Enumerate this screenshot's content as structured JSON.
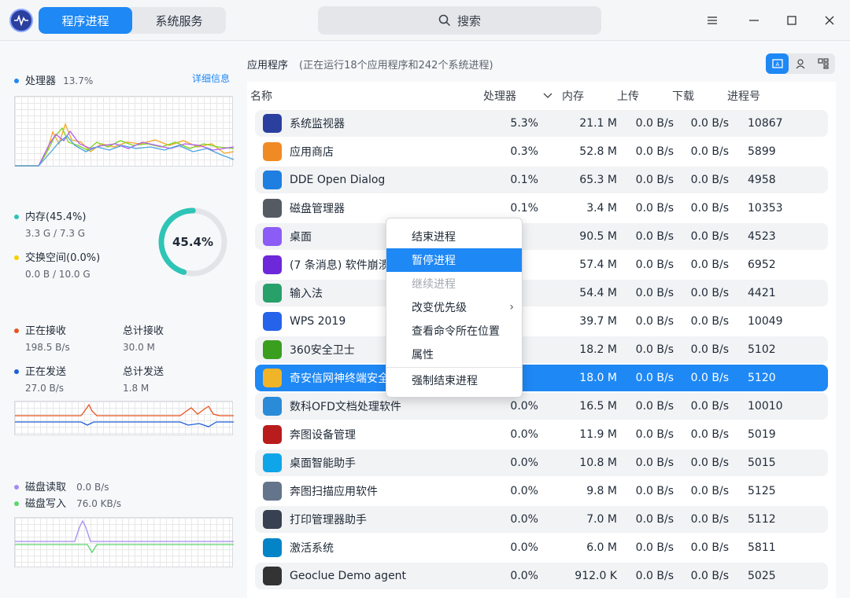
{
  "header": {
    "tabs": [
      "程序进程",
      "系统服务"
    ],
    "search_placeholder": "搜索"
  },
  "left": {
    "cpu": {
      "label": "处理器",
      "value": "13.7%",
      "detail_link": "详细信息"
    },
    "memory": {
      "label": "内存(45.4%)",
      "value": "3.3 G / 7.3 G",
      "percent": "45.4%"
    },
    "swap": {
      "label": "交换空间(0.0%)",
      "value": "0.0 B / 10.0 G"
    },
    "net": {
      "recv_label": "正在接收",
      "recv_value": "198.5 B/s",
      "total_recv_label": "总计接收",
      "total_recv_value": "30.0 M",
      "send_label": "正在发送",
      "send_value": "27.0 B/s",
      "total_send_label": "总计发送",
      "total_send_value": "1.8 M"
    },
    "disk": {
      "read_label": "磁盘读取",
      "read_value": "0.0 B/s",
      "write_label": "磁盘写入",
      "write_value": "76.0 KB/s"
    }
  },
  "main": {
    "title": "应用程序",
    "count": "(正在运行18个应用程序和242个系统进程)",
    "columns": [
      "名称",
      "处理器",
      "内存",
      "上传",
      "下载",
      "进程号"
    ],
    "rows": [
      {
        "name": "系统监视器",
        "cpu": "5.3%",
        "mem": "21.1 M",
        "up": "0.0 B/s",
        "down": "0.0 B/s",
        "pid": "10867",
        "icon": "monitor-icon",
        "color": "#2b3f9f"
      },
      {
        "name": "应用商店",
        "cpu": "0.3%",
        "mem": "52.8 M",
        "up": "0.0 B/s",
        "down": "0.0 B/s",
        "pid": "5899",
        "icon": "store-icon",
        "color": "#f08a24"
      },
      {
        "name": "DDE Open Dialog",
        "cpu": "0.1%",
        "mem": "65.3 M",
        "up": "0.0 B/s",
        "down": "0.0 B/s",
        "pid": "4958",
        "icon": "dialog-icon",
        "color": "#1e7fe0"
      },
      {
        "name": "磁盘管理器",
        "cpu": "0.1%",
        "mem": "3.4 M",
        "up": "0.0 B/s",
        "down": "0.0 B/s",
        "pid": "10353",
        "icon": "disk-icon",
        "color": "#555b63"
      },
      {
        "name": "桌面",
        "cpu": "",
        "mem": "90.5 M",
        "up": "0.0 B/s",
        "down": "0.0 B/s",
        "pid": "4523",
        "icon": "desktop-icon",
        "color": "#8b5cf6"
      },
      {
        "name": "(7 条消息) 软件崩溃",
        "cpu": "",
        "mem": "57.4 M",
        "up": "0.0 B/s",
        "down": "0.0 B/s",
        "pid": "6952",
        "icon": "browser-icon",
        "color": "#6d28d9"
      },
      {
        "name": "输入法",
        "cpu": "",
        "mem": "54.4 M",
        "up": "0.0 B/s",
        "down": "0.0 B/s",
        "pid": "4421",
        "icon": "keyboard-icon",
        "color": "#27a06a"
      },
      {
        "name": "WPS 2019",
        "cpu": "",
        "mem": "39.7 M",
        "up": "0.0 B/s",
        "down": "0.0 B/s",
        "pid": "10049",
        "icon": "wps-icon",
        "color": "#2563eb"
      },
      {
        "name": "360安全卫士",
        "cpu": "",
        "mem": "18.2 M",
        "up": "0.0 B/s",
        "down": "0.0 B/s",
        "pid": "5102",
        "icon": "shield-icon",
        "color": "#3a9f1f"
      },
      {
        "name": "奇安信网神终端安全",
        "cpu": "",
        "mem": "18.0 M",
        "up": "0.0 B/s",
        "down": "0.0 B/s",
        "pid": "5120",
        "icon": "security-icon",
        "color": "#f0b429"
      },
      {
        "name": "数科OFD文档处理软件",
        "cpu": "0.0%",
        "mem": "16.5 M",
        "up": "0.0 B/s",
        "down": "0.0 B/s",
        "pid": "10010",
        "icon": "ofd-icon",
        "color": "#2a8bd8"
      },
      {
        "name": "奔图设备管理",
        "cpu": "0.0%",
        "mem": "11.9 M",
        "up": "0.0 B/s",
        "down": "0.0 B/s",
        "pid": "5019",
        "icon": "printer-icon",
        "color": "#b91c1c"
      },
      {
        "name": "桌面智能助手",
        "cpu": "0.0%",
        "mem": "10.8 M",
        "up": "0.0 B/s",
        "down": "0.0 B/s",
        "pid": "5015",
        "icon": "assistant-icon",
        "color": "#0ea5e9"
      },
      {
        "name": "奔图扫描应用软件",
        "cpu": "0.0%",
        "mem": "9.8 M",
        "up": "0.0 B/s",
        "down": "0.0 B/s",
        "pid": "5125",
        "icon": "scanner-icon",
        "color": "#64748b"
      },
      {
        "name": "打印管理器助手",
        "cpu": "0.0%",
        "mem": "7.0 M",
        "up": "0.0 B/s",
        "down": "0.0 B/s",
        "pid": "5112",
        "icon": "print-manager-icon",
        "color": "#374151"
      },
      {
        "name": "激活系统",
        "cpu": "0.0%",
        "mem": "6.0 M",
        "up": "0.0 B/s",
        "down": "0.0 B/s",
        "pid": "5811",
        "icon": "activate-icon",
        "color": "#0284c7"
      },
      {
        "name": "Geoclue Demo agent",
        "cpu": "0.0%",
        "mem": "912.0 K",
        "up": "0.0 B/s",
        "down": "0.0 B/s",
        "pid": "5025",
        "icon": "location-icon",
        "color": "#333333"
      }
    ]
  },
  "context_menu": {
    "items": [
      "结束进程",
      "暂停进程",
      "继续进程",
      "改变优先级",
      "查看命令所在位置",
      "属性",
      "强制结束进程"
    ]
  }
}
